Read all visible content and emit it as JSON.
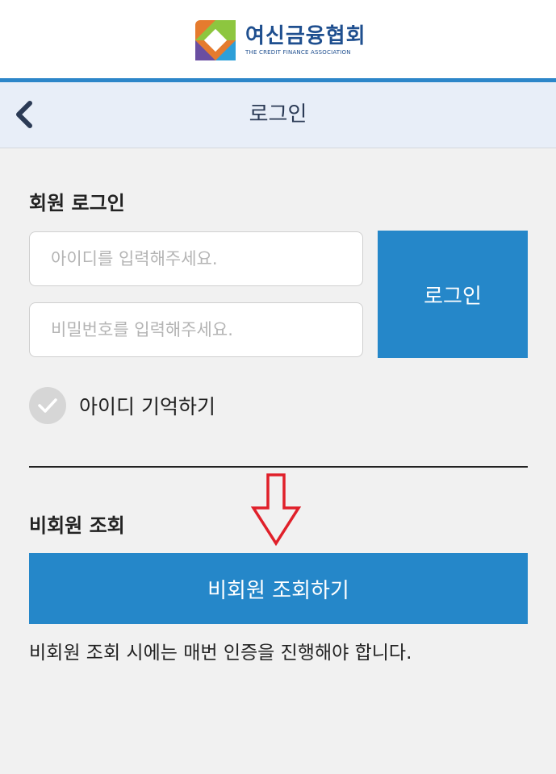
{
  "brand": {
    "name": "여신금융협회",
    "subtitle": "THE CREDIT FINANCE ASSOCIATION",
    "logo_icon": "diamond-logo-icon"
  },
  "header": {
    "title": "로그인",
    "back_icon": "chevron-left-icon"
  },
  "member_login": {
    "section_title": "회원 로그인",
    "id_placeholder": "아이디를 입력해주세요.",
    "id_value": "",
    "password_placeholder": "비밀번호를 입력해주세요.",
    "password_value": "",
    "login_button": "로그인",
    "remember_label": "아이디 기억하기",
    "remember_checked": false
  },
  "guest": {
    "section_title": "비회원 조회",
    "button_label": "비회원 조회하기",
    "note": "비회원 조회 시에는 매번 인증을 진행해야 합니다."
  },
  "colors": {
    "accent": "#2587c9",
    "header_bg": "#e8eef8",
    "annotation_arrow": "#e0202a"
  }
}
